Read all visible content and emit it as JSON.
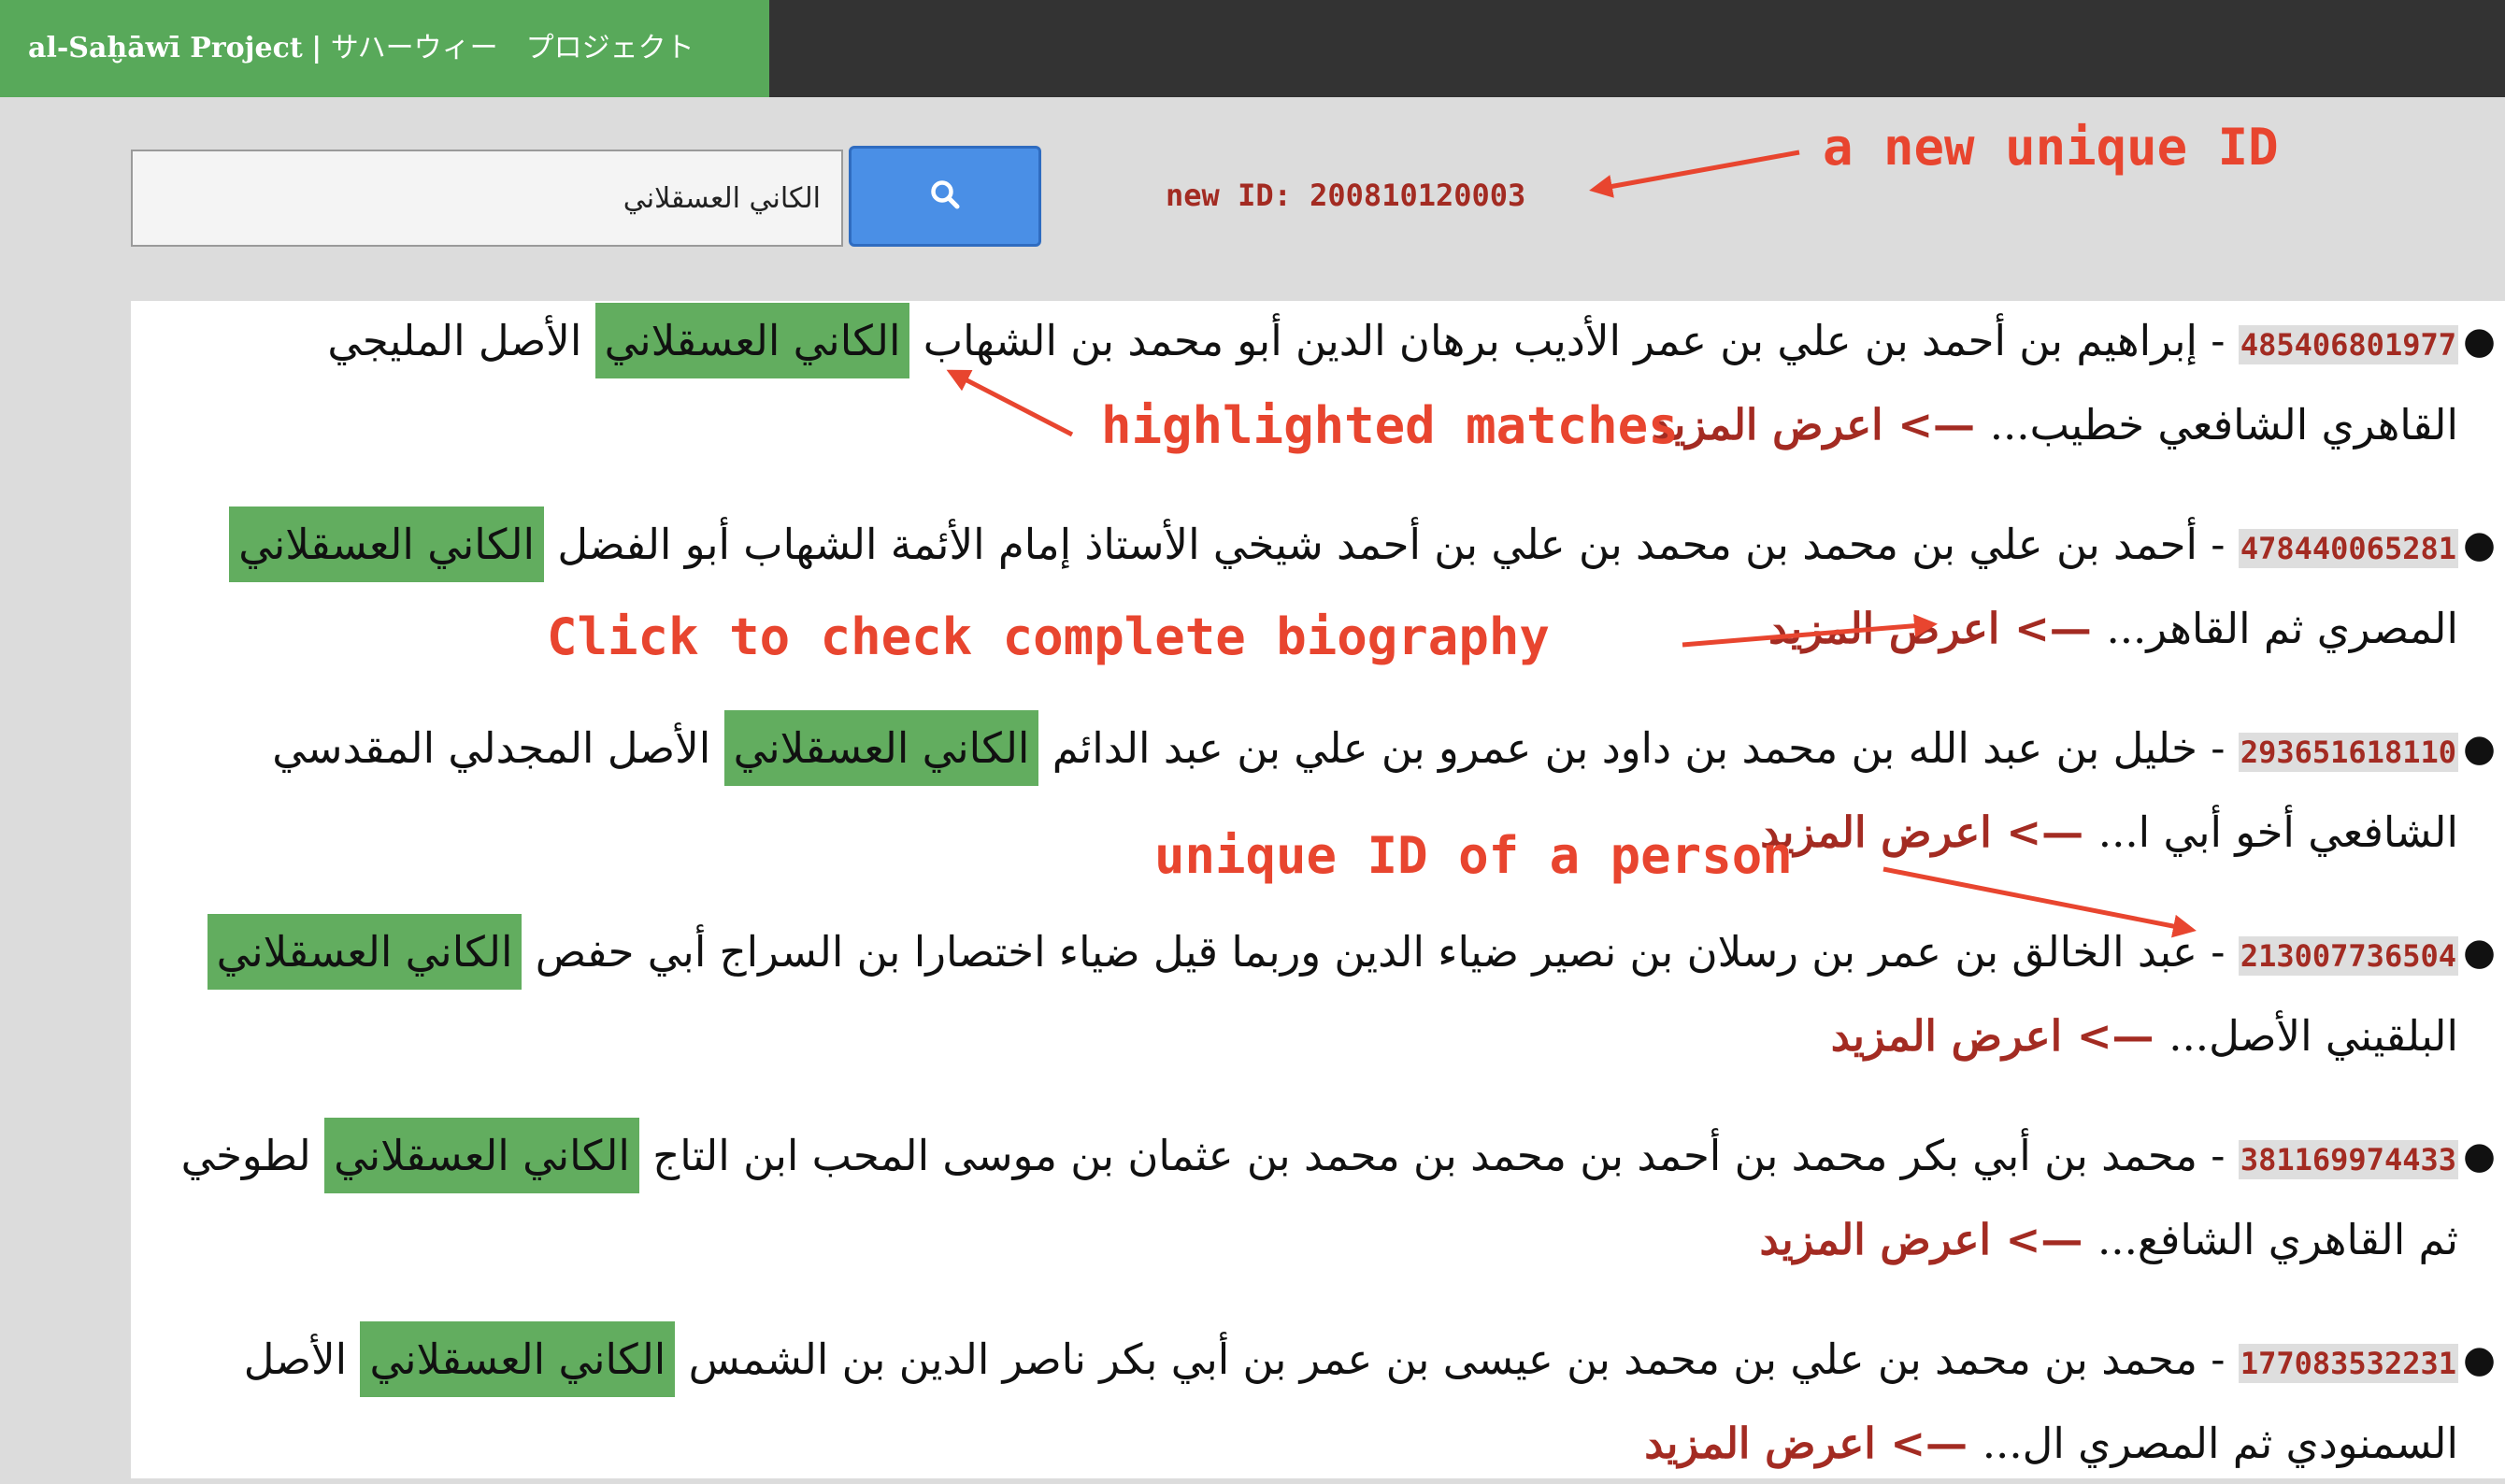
{
  "header": {
    "brand_name": "al-Saḫāwī Project",
    "separator": "|",
    "brand_subtitle": "サハーウィー　プロジェクト",
    "colors": {
      "bar": "#333333",
      "brand_bg": "#58a95a"
    }
  },
  "search": {
    "query": "الكاني العسقلاني",
    "button_icon": "search-icon",
    "button_color": "#4a8fe6"
  },
  "new_id": {
    "label": "new ID:",
    "value": "200810120003"
  },
  "results": [
    {
      "id": "485406801977",
      "dash": " - ",
      "before": "إبراهيم بن أحمد بن علي بن عمر الأديب برهان الدين أبو محمد بن الشهاب ",
      "match": "الكاني العسقلاني",
      "after": " الأصل المليجي القاهري الشافعي خطيب...",
      "more": " —> اعرض المزيد"
    },
    {
      "id": "478440065281",
      "dash": " - ",
      "before": "أحمد بن علي بن محمد بن محمد بن علي بن أحمد شيخي الأستاذ إمام الأئمة الشهاب أبو الفضل ",
      "match": "الكاني العسقلاني",
      "after": " المصري ثم القاهر...",
      "more": " —> اعرض المزيد"
    },
    {
      "id": "293651618110",
      "dash": " - ",
      "before": "خليل بن عبد الله بن محمد بن داود بن عمرو بن علي بن عبد الدائم ",
      "match": "الكاني العسقلاني",
      "after": " الأصل المجدلي المقدسي الشافعي أخو أبي ا...",
      "more": " —> اعرض المزيد"
    },
    {
      "id": "213007736504",
      "dash": " - ",
      "before": "عبد الخالق بن عمر بن رسلان بن نصير ضياء الدين وربما قيل ضياء اختصارا بن السراج أبي حفص ",
      "match": "الكاني العسقلاني",
      "after": " البلقيني الأصل...",
      "more": " —> اعرض المزيد"
    },
    {
      "id": "381169974433",
      "dash": " - ",
      "before": "محمد بن أبي بكر محمد بن أحمد بن محمد بن محمد بن عثمان بن موسى المحب ابن التاج ",
      "match": "الكاني العسقلاني",
      "after": " لطوخي ثم القاهري الشافع...",
      "more": " —> اعرض المزيد"
    },
    {
      "id": "177083532231",
      "dash": " - ",
      "before": "محمد بن محمد بن علي بن محمد بن عيسى بن عمر بن أبي بكر ناصر الدين بن الشمس ",
      "match": "الكاني العسقلاني",
      "after": " الأصل السمنودي ثم المصري ال...",
      "more": " —> اعرض المزيد"
    }
  ],
  "annotations": {
    "new_id_note": "a new unique ID",
    "highlight_note": "highlighted matches",
    "click_note": "Click to check complete biography",
    "person_id_note": "unique ID of a person",
    "color": "#e8452f"
  }
}
